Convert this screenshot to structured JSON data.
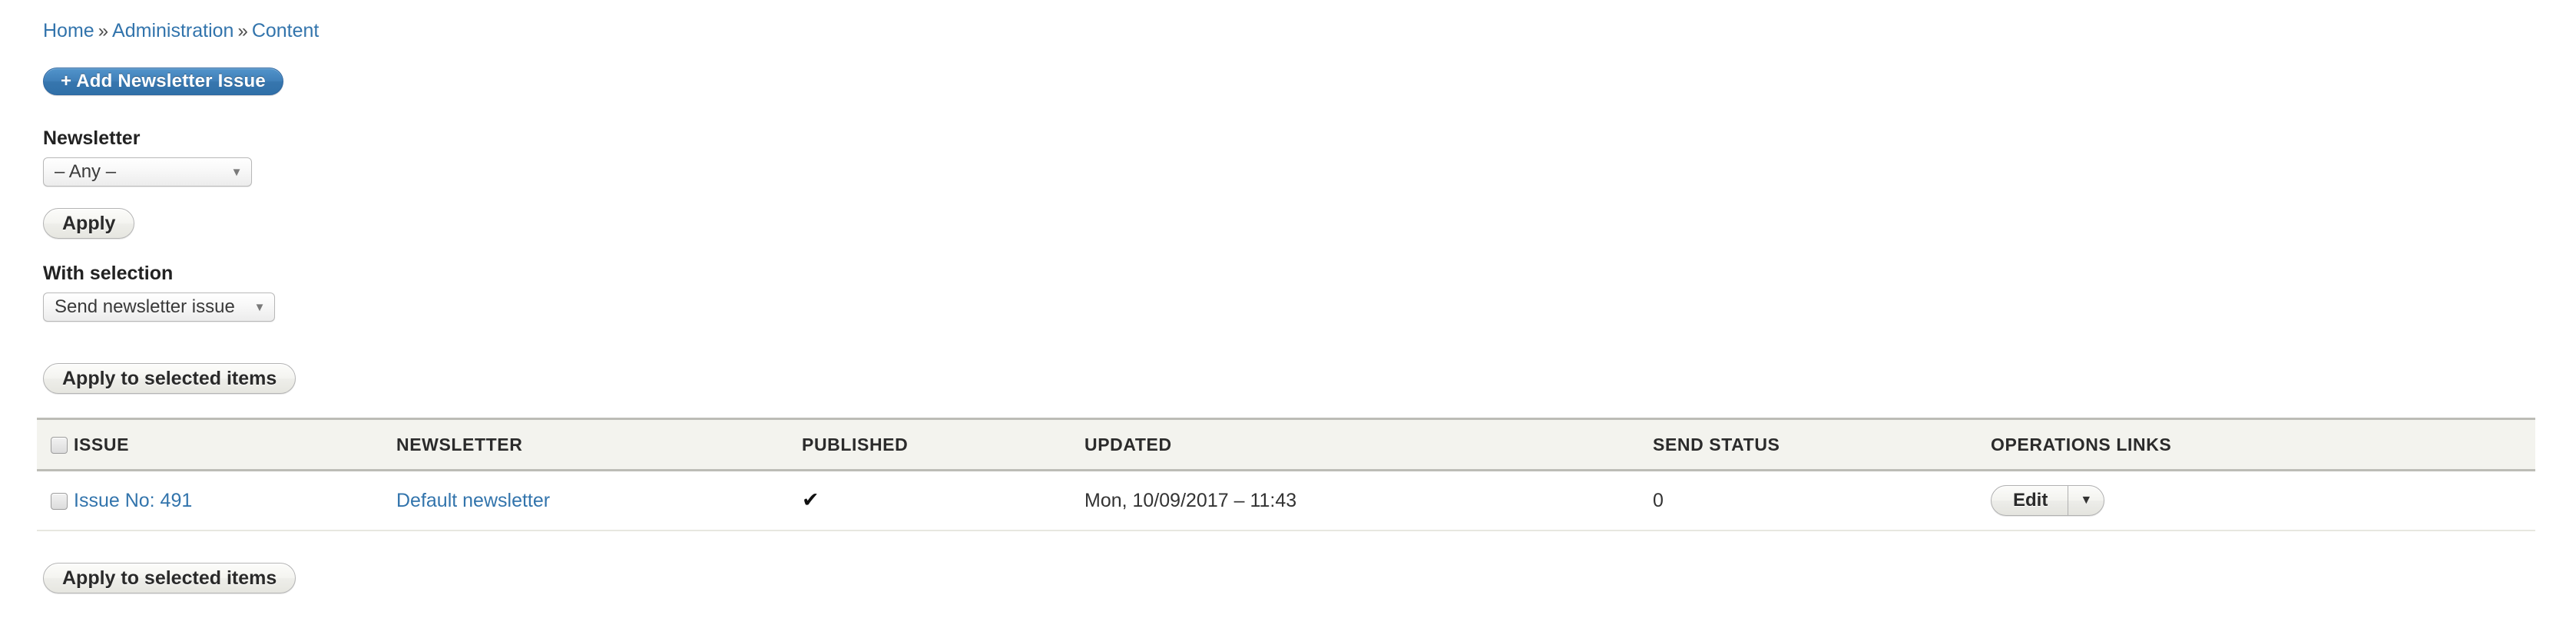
{
  "breadcrumb": {
    "items": [
      "Home",
      "Administration",
      "Content"
    ],
    "separator": "»"
  },
  "actions": {
    "add_label": "+ Add Newsletter Issue"
  },
  "filters": {
    "newsletter": {
      "label": "Newsletter",
      "value": "– Any –",
      "arrow": "▼"
    },
    "apply_label": "Apply"
  },
  "bulk": {
    "label": "With selection",
    "action": {
      "value": "Send newsletter issue",
      "arrow": "▼"
    },
    "apply_top_label": "Apply to selected items",
    "apply_bottom_label": "Apply to selected items"
  },
  "table": {
    "columns": [
      "",
      "ISSUE",
      "NEWSLETTER",
      "PUBLISHED",
      "UPDATED",
      "SEND STATUS",
      "OPERATIONS LINKS"
    ],
    "rows": [
      {
        "issue": "Issue No: 491",
        "newsletter": "Default newsletter",
        "published": "✔",
        "updated": "Mon, 10/09/2017 – 11:43",
        "send_status": "0",
        "operation_label": "Edit",
        "operation_arrow": "▼"
      }
    ]
  },
  "colors": {
    "link": "#3274ac",
    "primary_button": "#3776ae",
    "header_bg": "#f3f3ee",
    "header_border": "#bcbcb6",
    "row_border": "#e7e7e0"
  }
}
